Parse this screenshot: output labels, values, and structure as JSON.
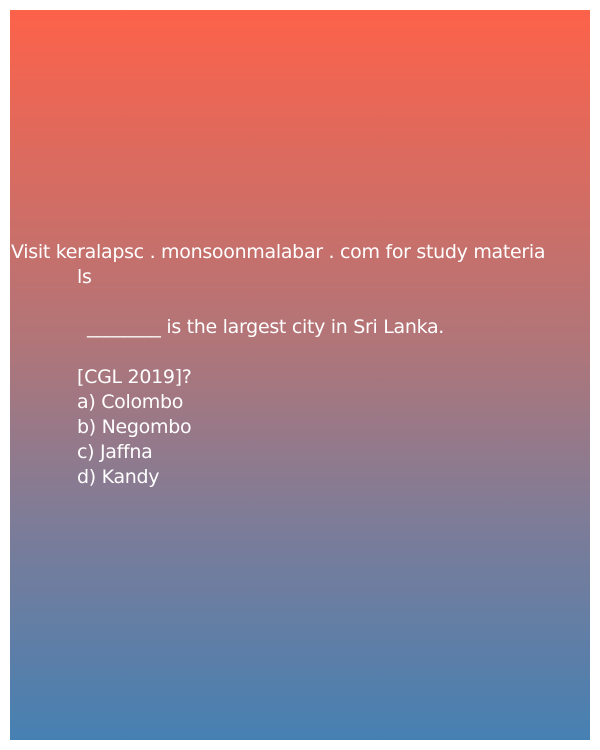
{
  "promo": {
    "line1": "Visit keralapsc . monsoonmalabar . com for study materia",
    "line2": "ls"
  },
  "question": {
    "text": "________ is the largest city in Sri Lanka.",
    "source": "[CGL 2019]?"
  },
  "options": [
    "a) Colombo",
    "b) Negombo",
    "c) Jaffna",
    "d) Kandy"
  ],
  "colors": {
    "gradient_top": "#fd624a",
    "gradient_bottom": "#4680b2",
    "text": "#ffffff"
  }
}
